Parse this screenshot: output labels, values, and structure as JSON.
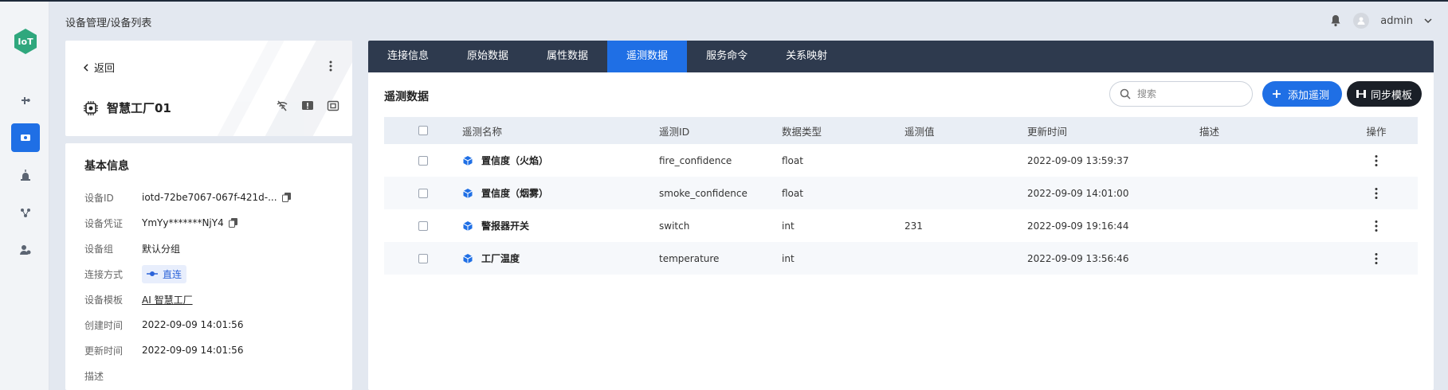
{
  "rail": {
    "logo": "IoT",
    "icons": [
      "plugin-icon",
      "device-icon",
      "alarm-icon",
      "network-icon",
      "settings-icon"
    ]
  },
  "header": {
    "breadcrumb": "设备管理/设备列表",
    "user": "admin"
  },
  "device": {
    "back_label": "返回",
    "name": "智慧工厂01"
  },
  "info": {
    "title": "基本信息",
    "rows": [
      {
        "key": "设备ID",
        "value": "iotd-72be7067-067f-421d-..."
      },
      {
        "key": "设备凭证",
        "value": "YmYy*******NjY4"
      },
      {
        "key": "设备组",
        "value": "默认分组"
      },
      {
        "key": "连接方式",
        "value": "直连"
      },
      {
        "key": "设备模板",
        "value": "AI 智慧工厂"
      },
      {
        "key": "创建时间",
        "value": "2022-09-09 14:01:56"
      },
      {
        "key": "更新时间",
        "value": "2022-09-09 14:01:56"
      },
      {
        "key": "描述",
        "value": ""
      }
    ]
  },
  "tabs": [
    "连接信息",
    "原始数据",
    "属性数据",
    "遥测数据",
    "服务命令",
    "关系映射"
  ],
  "active_tab": 3,
  "section": {
    "title": "遥测数据",
    "search_placeholder": "搜索",
    "add_label": "添加遥测",
    "sync_label": "同步模板"
  },
  "table": {
    "headers": {
      "name": "遥测名称",
      "id": "遥测ID",
      "type": "数据类型",
      "value": "遥测值",
      "time": "更新时间",
      "desc": "描述",
      "op": "操作"
    },
    "rows": [
      {
        "name": "置信度（火焰）",
        "id": "fire_confidence",
        "type": "float",
        "value": "",
        "time": "2022-09-09 13:59:37",
        "desc": ""
      },
      {
        "name": "置信度（烟雾）",
        "id": "smoke_confidence",
        "type": "float",
        "value": "",
        "time": "2022-09-09 14:01:00",
        "desc": ""
      },
      {
        "name": "警报器开关",
        "id": "switch",
        "type": "int",
        "value": "231",
        "time": "2022-09-09 19:16:44",
        "desc": ""
      },
      {
        "name": "工厂温度",
        "id": "temperature",
        "type": "int",
        "value": "",
        "time": "2022-09-09 13:56:46",
        "desc": ""
      }
    ]
  },
  "colors": {
    "accent": "#1f6fe5",
    "tabbar": "#2e3a4e",
    "logo": "#2fa77d"
  }
}
